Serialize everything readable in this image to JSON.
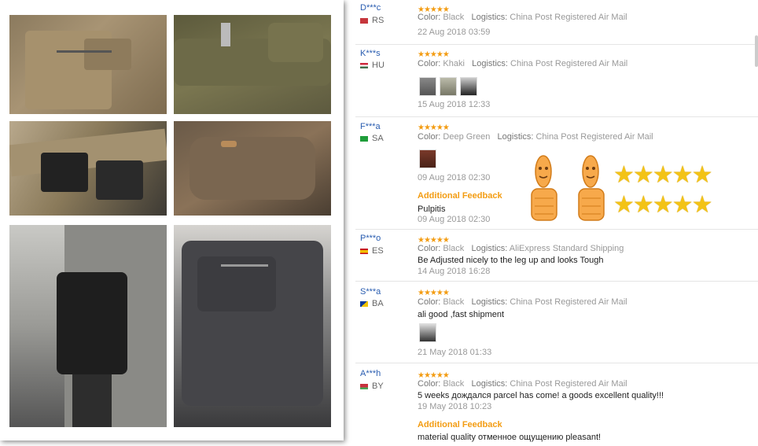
{
  "reviews": [
    {
      "user": "D***c",
      "country": "RS",
      "flag_color": "#c6363c",
      "stars": "★★★★★",
      "color_label": "Color:",
      "color": "Black",
      "logistics_label": "Logistics:",
      "logistics": "China Post Registered Air Mail",
      "date": "22 Aug 2018 03:59"
    },
    {
      "user": "K***s",
      "country": "HU",
      "flag_color": "#436f4d",
      "stars": "★★★★★",
      "color_label": "Color:",
      "color": "Khaki",
      "logistics_label": "Logistics:",
      "logistics": "China Post Registered Air Mail",
      "date": "15 Aug 2018 12:33"
    },
    {
      "user": "F***a",
      "country": "SA",
      "flag_color": "#1f9d3a",
      "stars": "★★★★★",
      "color_label": "Color:",
      "color": "Deep Green",
      "logistics_label": "Logistics:",
      "logistics": "China Post Registered Air Mail",
      "date": "09 Aug 2018 02:30",
      "additional_label": "Additional Feedback",
      "additional_text": "Pulpitis",
      "additional_date": "09 Aug 2018 02:30"
    },
    {
      "user": "P***o",
      "country": "ES",
      "flag_color": "#f1bf00",
      "stars": "★★★★★",
      "color_label": "Color:",
      "color": "Black",
      "logistics_label": "Logistics:",
      "logistics": "AliExpress Standard Shipping",
      "text": "Be Adjusted nicely to the leg up and looks Tough",
      "date": "14 Aug 2018 16:28"
    },
    {
      "user": "S***a",
      "country": "BA",
      "flag_color": "#0d3b9c",
      "stars": "★★★★★",
      "color_label": "Color:",
      "color": "Black",
      "logistics_label": "Logistics:",
      "logistics": "China Post Registered Air Mail",
      "text": "ali good ,fast shipment",
      "date": "21 May 2018 01:33"
    },
    {
      "user": "A***h",
      "country": "BY",
      "flag_color": "#c8313e",
      "stars": "★★★★★",
      "color_label": "Color:",
      "color": "Black",
      "logistics_label": "Logistics:",
      "logistics": "China Post Registered Air Mail",
      "text": "5 weeks дождался parcel has come! a goods excellent quality!!!",
      "date": "19 May 2018 10:23",
      "additional_label": "Additional Feedback",
      "additional_text": "material quality отменное ощущению pleasant!"
    }
  ],
  "overlay": {
    "stars_row1": "★★★★★",
    "stars_row2": "★★★★★"
  }
}
